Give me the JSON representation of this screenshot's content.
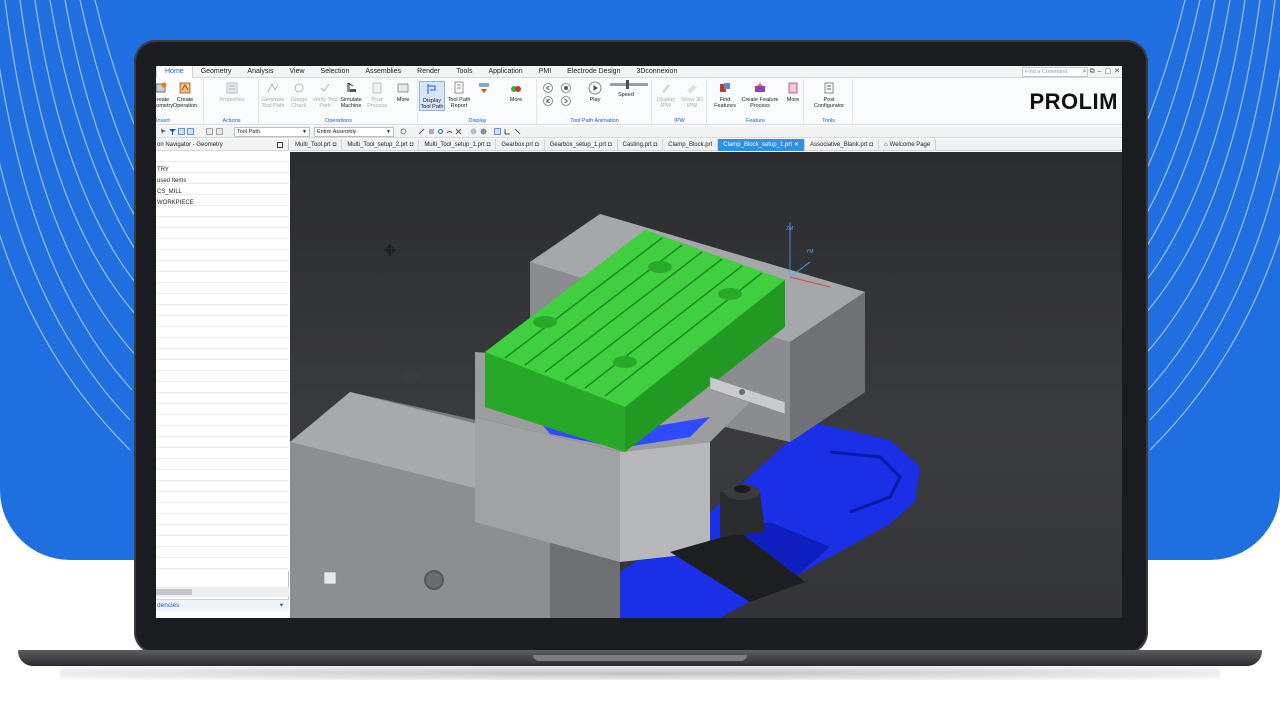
{
  "brand": {
    "logo_text": "PROLIM"
  },
  "menubar": {
    "tabs": [
      "Home",
      "Geometry",
      "Analysis",
      "View",
      "Selection",
      "Assemblies",
      "Render",
      "Tools",
      "Application",
      "PMI",
      "Electrode Design",
      "3Dconnexion"
    ],
    "search_placeholder": "Find a Command"
  },
  "ribbon": {
    "groups": [
      {
        "label": "Insert",
        "buttons": [
          "Create Geometry",
          "Create Operation"
        ]
      },
      {
        "label": "Actions",
        "buttons": [
          "Properties"
        ]
      },
      {
        "label": "Operations",
        "buttons": [
          "Generate Tool Path",
          "Gouge Check",
          "Verify Tool Path",
          "Simulate Machine",
          "Post Process",
          "More"
        ]
      },
      {
        "label": "Display",
        "buttons": [
          "Display Tool Path",
          "Tool Path Report",
          "More"
        ]
      },
      {
        "label": "Tool Path Animation",
        "buttons": [
          "Play",
          "Speed"
        ]
      },
      {
        "label": "IPW",
        "buttons": [
          "Display IPW",
          "Show 3D IPW"
        ]
      },
      {
        "label": "Feature",
        "buttons": [
          "Find Features",
          "Create Feature Process",
          "More"
        ]
      },
      {
        "label": "Tools",
        "buttons": [
          "Post Configurator"
        ]
      }
    ]
  },
  "toolbar": {
    "filter_value": "Tool Path",
    "assembly_value": "Entire Assembly"
  },
  "file_tabs": [
    {
      "label": "Multi_Tool.prt",
      "active": false
    },
    {
      "label": "Multi_Tool_setup_2.prt",
      "active": false
    },
    {
      "label": "Multi_Tool_setup_1.prt",
      "active": false
    },
    {
      "label": "Gearbox.prt",
      "active": false
    },
    {
      "label": "Gearbox_setup_1.prt",
      "active": false
    },
    {
      "label": "Casting.prt",
      "active": false
    },
    {
      "label": "Clamp_Block.prt",
      "active": false
    },
    {
      "label": "Clamp_Block_setup_1.prt",
      "active": true
    },
    {
      "label": "Associative_Blank.prt",
      "active": false
    },
    {
      "label": "Welcome Page",
      "active": false
    }
  ],
  "navigator": {
    "title": "on Navigator - Geometry",
    "items": [
      "TRY",
      "used Items",
      "CS_MILL",
      "WORKPIECE"
    ],
    "dependencies_label": "dencies"
  },
  "viewport": {
    "triad_labels": [
      "ZM",
      "YM"
    ]
  },
  "colors": {
    "background_blue": "#1f6fe0",
    "workpiece_green": "#2eb82e",
    "fixture_blue": "#1a2fe6",
    "accent_tab": "#2f8fe0"
  }
}
